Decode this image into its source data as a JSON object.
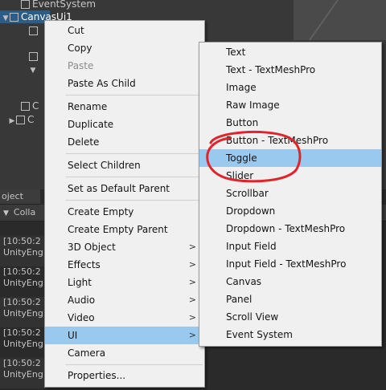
{
  "hierarchy": {
    "items": [
      {
        "label": "EventSystem"
      },
      {
        "label": "CanvasUi1"
      },
      {
        "label": "C"
      },
      {
        "label": "C"
      }
    ]
  },
  "console": {
    "tab_label": "oject",
    "collapse_label": "Colla",
    "logs": [
      {
        "time": "[10:50:2",
        "source": "UnityEng"
      },
      {
        "time": "[10:50:2",
        "source": "UnityEng"
      },
      {
        "time": "[10:50:2",
        "source": "UnityEng"
      },
      {
        "time": "[10:50:2",
        "source": "UnityEng"
      },
      {
        "time": "[10:50:2",
        "source": "UnityEng"
      }
    ]
  },
  "context_menu": {
    "items": [
      {
        "label": "Cut"
      },
      {
        "label": "Copy"
      },
      {
        "label": "Paste",
        "disabled": true
      },
      {
        "label": "Paste As Child"
      },
      {
        "label": "Rename"
      },
      {
        "label": "Duplicate"
      },
      {
        "label": "Delete"
      },
      {
        "label": "Select Children"
      },
      {
        "label": "Set as Default Parent"
      },
      {
        "label": "Create Empty"
      },
      {
        "label": "Create Empty Parent"
      },
      {
        "label": "3D Object",
        "submenu": true
      },
      {
        "label": "Effects",
        "submenu": true
      },
      {
        "label": "Light",
        "submenu": true
      },
      {
        "label": "Audio",
        "submenu": true
      },
      {
        "label": "Video",
        "submenu": true
      },
      {
        "label": "UI",
        "submenu": true,
        "highlighted": true
      },
      {
        "label": "Camera"
      },
      {
        "label": "Properties..."
      }
    ]
  },
  "ui_submenu": {
    "items": [
      {
        "label": "Text"
      },
      {
        "label": "Text - TextMeshPro"
      },
      {
        "label": "Image"
      },
      {
        "label": "Raw Image"
      },
      {
        "label": "Button"
      },
      {
        "label": "Button - TextMeshPro"
      },
      {
        "label": "Toggle",
        "highlighted": true
      },
      {
        "label": "Slider"
      },
      {
        "label": "Scrollbar"
      },
      {
        "label": "Dropdown"
      },
      {
        "label": "Dropdown - TextMeshPro"
      },
      {
        "label": "Input Field"
      },
      {
        "label": "Input Field - TextMeshPro"
      },
      {
        "label": "Canvas"
      },
      {
        "label": "Panel"
      },
      {
        "label": "Scroll View"
      },
      {
        "label": "Event System"
      }
    ]
  },
  "icons": {
    "gameobject": "cube-icon",
    "expand": "triangle-icon",
    "submenu": "chevron-right-icon"
  },
  "colors": {
    "menu_highlight": "#99c9ef",
    "selection": "#2c5d87",
    "annotation": "#e0242a"
  }
}
